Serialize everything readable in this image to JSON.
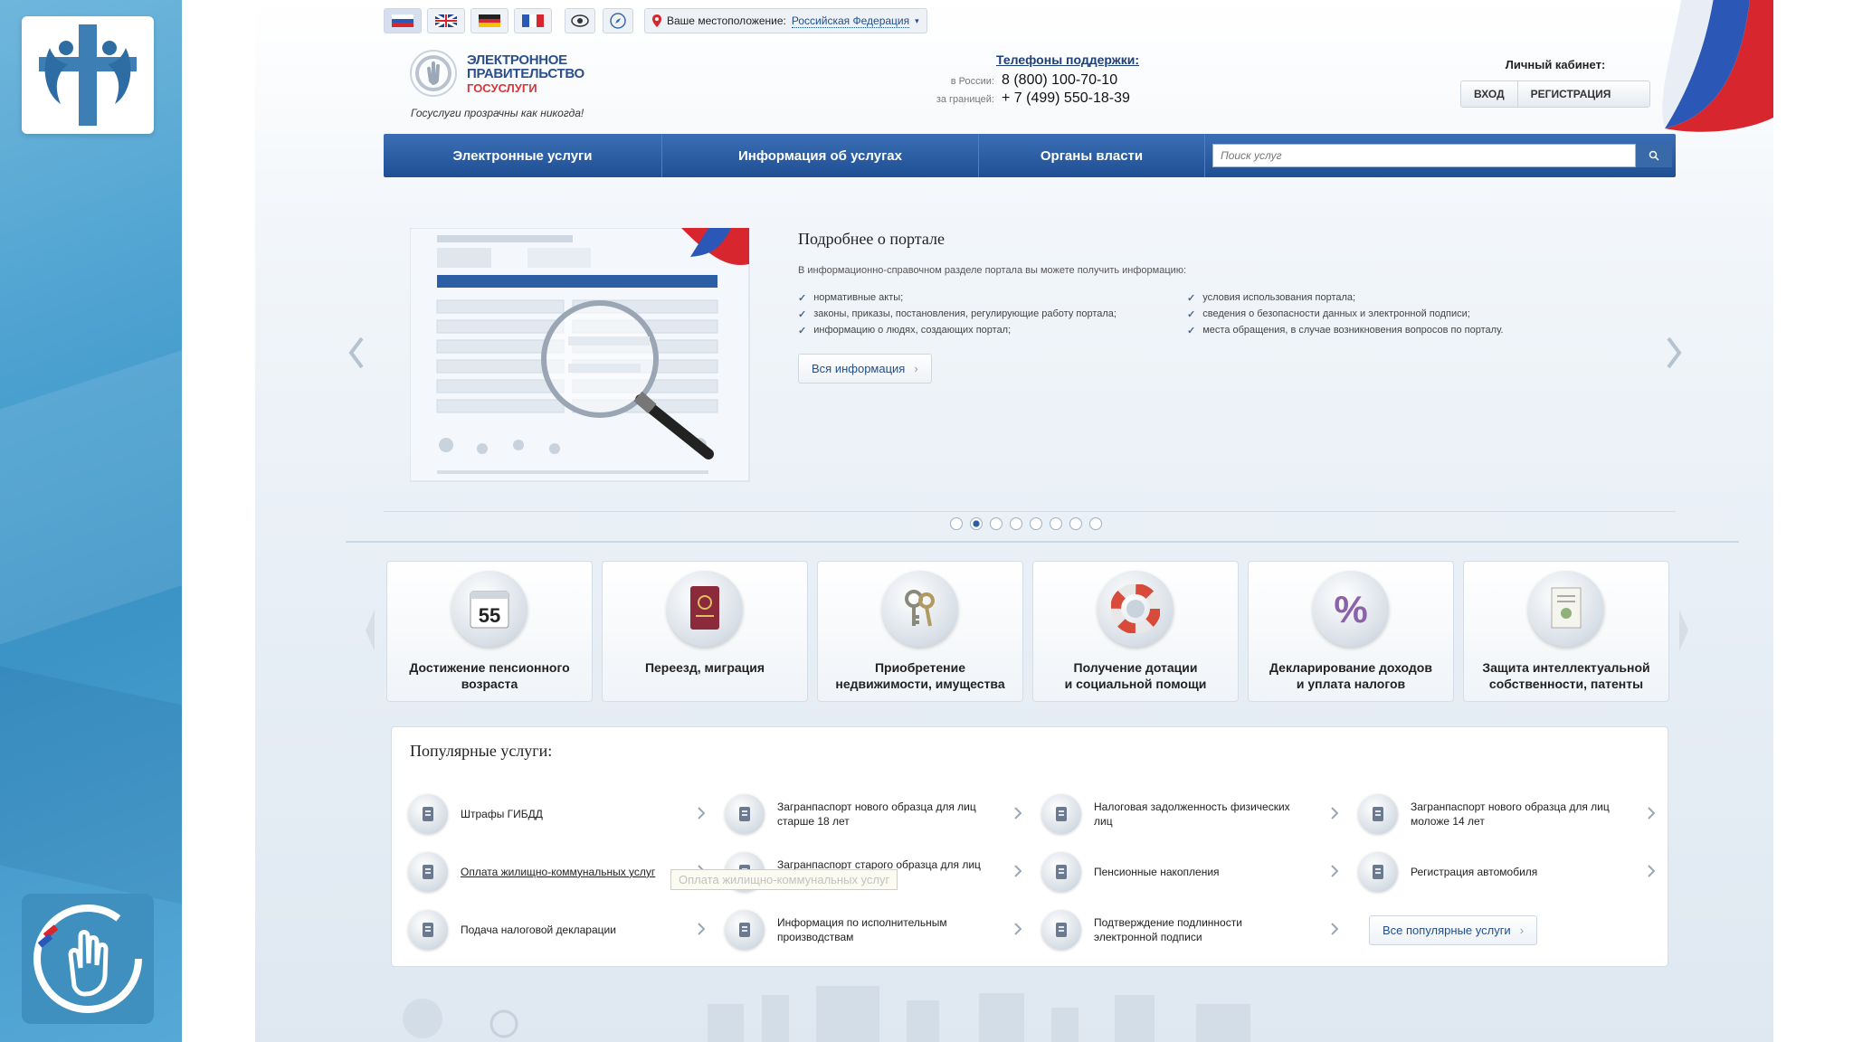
{
  "top_bar": {
    "languages": [
      {
        "name": "ru-flag-icon",
        "colors": [
          "#ffffff",
          "#2b58b7",
          "#d7262e"
        ]
      },
      {
        "name": "gb-flag-icon",
        "colors": [
          "#1f3f8f",
          "#ffffff",
          "#d7262e"
        ]
      },
      {
        "name": "de-flag-icon",
        "colors": [
          "#222222",
          "#d7262e",
          "#f2c100"
        ]
      },
      {
        "name": "fr-flag-icon",
        "colors": [
          "#2b58b7",
          "#ffffff",
          "#d7262e"
        ]
      }
    ],
    "accessibility_icon": "eye-icon",
    "compass_icon": "compass-icon",
    "location_label": "Ваше местоположение:",
    "location_value": "Российская Федерация"
  },
  "header": {
    "logo_line1": "ЭЛЕКТРОННОЕ",
    "logo_line2": "ПРАВИТЕЛЬСТВО",
    "logo_line3": "ГОСУСЛУГИ",
    "slogan": "Госуслуги прозрачны как никогда!",
    "support_title": "Телефоны поддержки:",
    "support_russia_label": "в России:",
    "support_russia_phone": "8 (800) 100-70-10",
    "support_abroad_label": "за границей:",
    "support_abroad_phone": "+ 7 (499) 550-18-39",
    "cabinet_title": "Личный кабинет:",
    "login_label": "ВХОД",
    "register_label": "РЕГИСТРАЦИЯ"
  },
  "nav": {
    "items": [
      "Электронные услуги",
      "Информация об услугах",
      "Органы власти"
    ],
    "search_placeholder": "Поиск услуг"
  },
  "carousel": {
    "title": "Подробнее о портале",
    "description": "В информационно-справочном разделе портала вы можете получить информацию:",
    "col1": [
      "нормативные акты;",
      "законы, приказы, постановления, регулирующие работу портала;",
      "информацию о людях, создающих портал;"
    ],
    "col2": [
      "условия использования портала;",
      "сведения о безопасности данных и электронной подписи;",
      "места обращения, в случае возникновения вопросов по порталу."
    ],
    "more_button": "Вся информация",
    "slide_count": 8,
    "active_slide": 1
  },
  "categories": [
    {
      "label": "Достижение пенсионного\nвозраста",
      "icon": "pension-55-icon",
      "icon_text": "55"
    },
    {
      "label": "Переезд, миграция",
      "icon": "passport-icon"
    },
    {
      "label": "Приобретение\nнедвижимости, имущества",
      "icon": "keys-icon"
    },
    {
      "label": "Получение дотации\nи социальной помощи",
      "icon": "lifebuoy-icon"
    },
    {
      "label": "Декларирование доходов\nи уплата налогов",
      "icon": "percent-icon",
      "icon_text": "%"
    },
    {
      "label": "Защита интеллектуальной\nсобственности, патенты",
      "icon": "certificate-icon"
    }
  ],
  "popular": {
    "title": "Популярные услуги:",
    "items": [
      {
        "label": "Штрафы ГИБДД",
        "icon": "traffic-light-icon"
      },
      {
        "label": "Загранпаспорт нового образца для лиц старше 18 лет",
        "icon": "passport-icon"
      },
      {
        "label": "Налоговая задолженность физических лиц",
        "icon": "tax-debt-icon"
      },
      {
        "label": "Загранпаспорт нового образца для лиц моложе 14 лет",
        "icon": "passport-icon"
      },
      {
        "label": "Оплата жилищно-коммунальных услуг",
        "icon": "utilities-icon",
        "hover": true
      },
      {
        "label": "Загранпаспорт старого образца для лиц старше 18 лет",
        "icon": "passport-icon"
      },
      {
        "label": "Пенсионные накопления",
        "icon": "pension-icon"
      },
      {
        "label": "Регистрация автомобиля",
        "icon": "car-registration-icon"
      },
      {
        "label": "Подача налоговой декларации",
        "icon": "tax-declaration-icon"
      },
      {
        "label": "Информация по исполнительным производствам",
        "icon": "scales-icon"
      },
      {
        "label": "Подтверждение подлинности электронной подписи",
        "icon": "e-signature-icon"
      }
    ],
    "all_button": "Все популярные услуги",
    "tooltip": "Оплата жилищно-коммунальных услуг"
  },
  "colors": {
    "nav_blue": "#1f4f93",
    "link_blue": "#1d4f91",
    "accent_red": "#d8343a"
  }
}
